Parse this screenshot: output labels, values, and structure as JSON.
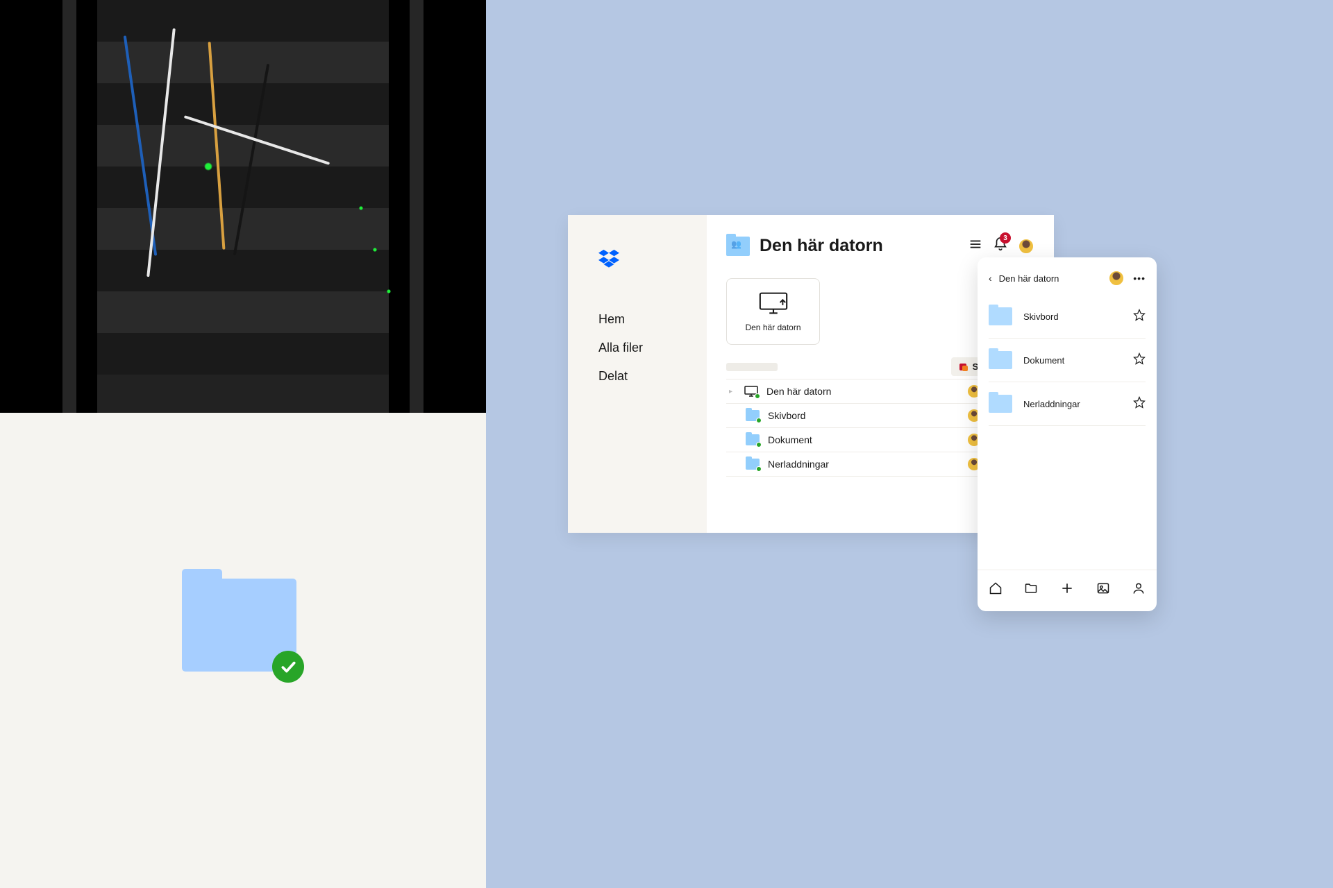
{
  "desktop": {
    "sidebar": {
      "nav": [
        {
          "label": "Hem"
        },
        {
          "label": "Alla filer"
        },
        {
          "label": "Delat"
        }
      ]
    },
    "header": {
      "title": "Den här datorn",
      "notification_count": "3"
    },
    "card": {
      "label": "Den här datorn"
    },
    "toolbar": {
      "create_label": "Skapa"
    },
    "rows": [
      {
        "name": "Den här datorn",
        "type": "computer",
        "indent": 0,
        "expandable": true
      },
      {
        "name": "Skivbord",
        "type": "folder",
        "indent": 1,
        "expandable": false
      },
      {
        "name": "Dokument",
        "type": "folder",
        "indent": 1,
        "expandable": false
      },
      {
        "name": "Nerladdningar",
        "type": "folder",
        "indent": 1,
        "expandable": false
      }
    ]
  },
  "mobile": {
    "header_title": "Den här datorn",
    "rows": [
      {
        "name": "Skivbord"
      },
      {
        "name": "Dokument"
      },
      {
        "name": "Nerladdningar"
      }
    ]
  }
}
